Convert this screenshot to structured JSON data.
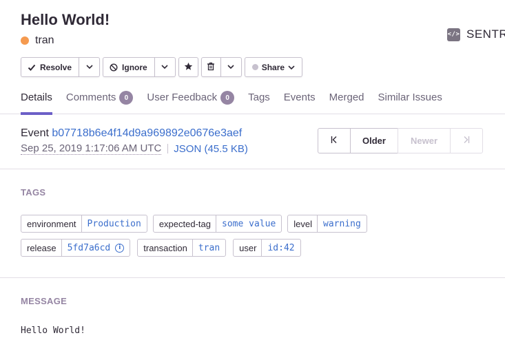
{
  "issue": {
    "title": "Hello World!",
    "culprit": "tran",
    "level_color": "#f59a4f"
  },
  "project": {
    "name": "SENTRY",
    "icon": "code-icon"
  },
  "actions": {
    "resolve_label": "Resolve",
    "ignore_label": "Ignore",
    "share_label": "Share",
    "bookmark_icon": "star-icon",
    "delete_icon": "trash-icon"
  },
  "tabs": [
    {
      "label": "Details",
      "active": true
    },
    {
      "label": "Comments",
      "badge": "0"
    },
    {
      "label": "User Feedback",
      "badge": "0"
    },
    {
      "label": "Tags"
    },
    {
      "label": "Events"
    },
    {
      "label": "Merged"
    },
    {
      "label": "Similar Issues"
    }
  ],
  "event": {
    "label": "Event",
    "id": "b07718b6e4f14d9a969892e0676e3aef",
    "date": "Sep 25, 2019 1:17:06 AM UTC",
    "json": "JSON (45.5 KB)"
  },
  "pager": {
    "first_icon": "first-page-icon",
    "older": "Older",
    "newer": "Newer",
    "last_icon": "last-page-icon"
  },
  "tags_section": {
    "title": "TAGS",
    "tags": [
      {
        "key": "environment",
        "value": "Production"
      },
      {
        "key": "expected-tag",
        "value": "some value"
      },
      {
        "key": "level",
        "value": "warning"
      },
      {
        "key": "release",
        "value": "5fd7a6cd"
      },
      {
        "key": "transaction",
        "value": "tran"
      },
      {
        "key": "user",
        "value": "id:42"
      }
    ]
  },
  "message_section": {
    "title": "MESSAGE",
    "body": "Hello World!"
  },
  "colors": {
    "accent": "#6c5fc7",
    "link": "#3b6ecc",
    "muted": "#9585a3",
    "border": "#c7c1ce"
  }
}
